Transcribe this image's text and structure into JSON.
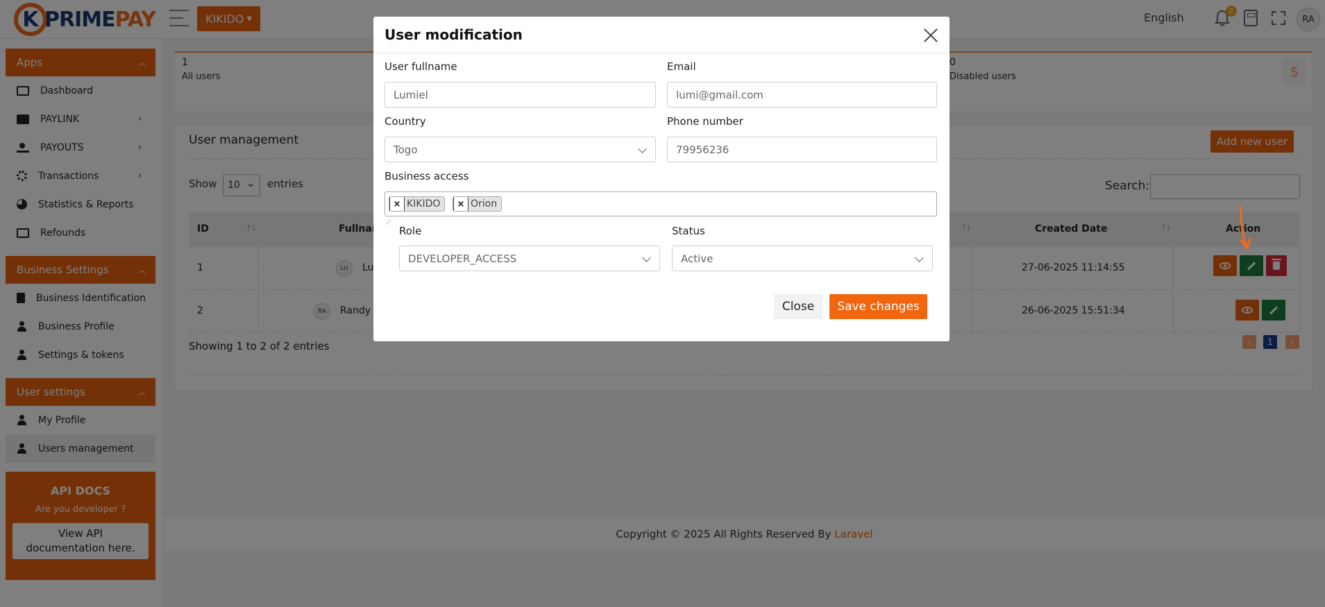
{
  "brand": {
    "logo_k": "K",
    "logo_text_prime": "PRIME",
    "logo_text_pay": "PAY"
  },
  "header": {
    "business_name": "KIKIDO",
    "language": "English",
    "notif_count": "2",
    "user_initials": "RA"
  },
  "sidebar": {
    "apps_title": "Apps",
    "apps_items": [
      {
        "label": "Dashboard"
      },
      {
        "label": "PAYLINK"
      },
      {
        "label": "PAYOUTS"
      },
      {
        "label": "Transactions"
      },
      {
        "label": "Statistics & Reports"
      },
      {
        "label": "Refounds"
      }
    ],
    "business_title": "Business Settings",
    "business_items": [
      {
        "label": "Business Identification"
      },
      {
        "label": "Business Profile"
      },
      {
        "label": "Settings & tokens"
      }
    ],
    "user_title": "User settings",
    "user_items": [
      {
        "label": "My Profile"
      },
      {
        "label": "Users management"
      }
    ],
    "api_docs": {
      "title": "API DOCS",
      "subtitle": "Are you developer ?",
      "button": "View API documentation here."
    }
  },
  "stats": {
    "all_count": "1",
    "all_label": "All users",
    "disabled_count": "0",
    "disabled_label": "Disabled users",
    "currency_symbol": "$"
  },
  "user_management": {
    "title": "User management",
    "add_button": "Add new user",
    "show_label": "Show",
    "entries_value": "10",
    "entries_label": "entries",
    "search_label": "Search:",
    "columns": {
      "id": "ID",
      "fullname": "Fullnam",
      "created": "Created Date",
      "action": "Action"
    },
    "rows": [
      {
        "id": "1",
        "initials": "LU",
        "name": "Lu",
        "created": "27-06-2025 11:14:55"
      },
      {
        "id": "2",
        "initials": "RA",
        "name": "Randy A",
        "created": "26-06-2025 15:51:34"
      }
    ],
    "showing": "Showing 1 to 2 of 2 entries",
    "pagination": {
      "prev": "‹",
      "current": "1",
      "next": "›"
    }
  },
  "footer": {
    "copyright": "Copyright © 2025 All Rights Reserved By",
    "link": "Laravel"
  },
  "modal": {
    "title": "User modification",
    "fullname_label": "User fullname",
    "fullname_value": "Lumiel",
    "email_label": "Email",
    "email_value": "lumi@gmail.com",
    "country_label": "Country",
    "country_value": "Togo",
    "phone_label": "Phone number",
    "phone_value": "79956236",
    "business_label": "Business access",
    "business_tags": [
      "KIKIDO",
      "Orion"
    ],
    "role_label": "Role",
    "role_value": "DEVELOPER_ACCESS",
    "status_label": "Status",
    "status_value": "Active",
    "close_button": "Close",
    "save_button": "Save changes"
  },
  "colors": {
    "accent": "#e8610c",
    "edit": "#1d7d3a",
    "delete": "#d42a3a",
    "pager_current": "#1c3b8e"
  }
}
